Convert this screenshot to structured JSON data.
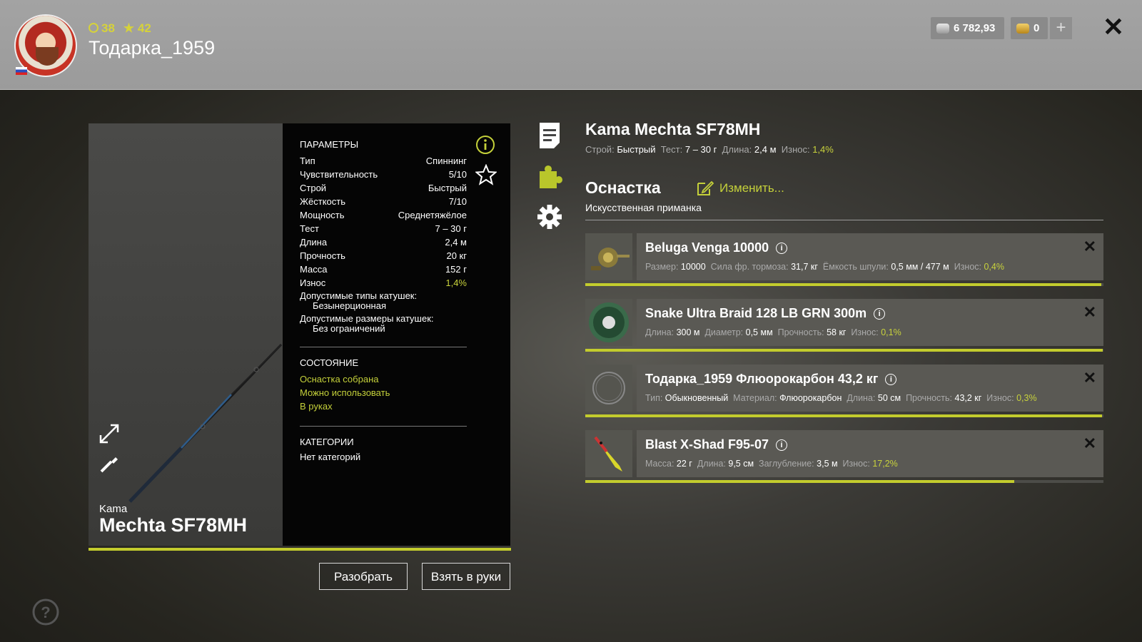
{
  "header": {
    "level": "38",
    "stars": "42",
    "player_name": "Тодарка_1959",
    "silver": "6 782,93",
    "gold": "0"
  },
  "rod": {
    "brand": "Kama",
    "model": "Mechta SF78MH",
    "title": "Kama Mechta SF78MH",
    "wear_fraction": 0.986
  },
  "params": {
    "section_title": "ПАРАМЕТРЫ",
    "rows": [
      {
        "label": "Тип",
        "value": "Спиннинг"
      },
      {
        "label": "Чувствительность",
        "value": "5/10"
      },
      {
        "label": "Строй",
        "value": "Быстрый"
      },
      {
        "label": "Жёсткость",
        "value": "7/10"
      },
      {
        "label": "Мощность",
        "value": "Среднетяжёлое"
      },
      {
        "label": "Тест",
        "value": "7 – 30 г"
      },
      {
        "label": "Длина",
        "value": "2,4 м"
      },
      {
        "label": "Прочность",
        "value": "20 кг"
      },
      {
        "label": "Масса",
        "value": "152 г"
      },
      {
        "label": "Износ",
        "value": "1,4%"
      }
    ],
    "reel_types_label": "Допустимые типы катушек:",
    "reel_types_value": "Безынерционная",
    "reel_sizes_label": "Допустимые размеры катушек:",
    "reel_sizes_value": "Без ограничений",
    "state_title": "СОСТОЯНИЕ",
    "states": [
      "Оснастка собрана",
      "Можно использовать",
      "В руках"
    ],
    "categories_title": "КАТЕГОРИИ",
    "categories_value": "Нет категорий"
  },
  "buttons": {
    "disassemble": "Разобрать",
    "take": "Взять в руки"
  },
  "summary": {
    "build_label": "Строй:",
    "build_value": "Быстрый",
    "test_label": "Тест:",
    "test_value": "7 – 30 г",
    "length_label": "Длина:",
    "length_value": "2,4 м",
    "wear_label": "Износ:",
    "wear_value": "1,4%"
  },
  "tackle": {
    "title": "Оснастка",
    "edit_label": "Изменить...",
    "subtitle": "Искусственная приманка",
    "items": [
      {
        "name": "Beluga Venga 10000",
        "fields": [
          {
            "label": "Размер:",
            "value": "10000"
          },
          {
            "label": "Сила фр. тормоза:",
            "value": "31,7 кг"
          },
          {
            "label": "Ёмкость шпули:",
            "value": "0,5 мм / 477 м"
          }
        ],
        "wear_label": "Износ:",
        "wear_value": "0,4%",
        "condition": 0.996
      },
      {
        "name": "Snake Ultra Braid 128 LB GRN 300m",
        "fields": [
          {
            "label": "Длина:",
            "value": "300 м"
          },
          {
            "label": "Диаметр:",
            "value": "0,5 мм"
          },
          {
            "label": "Прочность:",
            "value": "58 кг"
          }
        ],
        "wear_label": "Износ:",
        "wear_value": "0,1%",
        "condition": 0.999
      },
      {
        "name": "Тодарка_1959 Флюорокарбон 43,2 кг",
        "fields": [
          {
            "label": "Тип:",
            "value": "Обыкновенный"
          },
          {
            "label": "Материал:",
            "value": "Флюорокарбон"
          },
          {
            "label": "Длина:",
            "value": "50 см"
          },
          {
            "label": "Прочность:",
            "value": "43,2 кг"
          }
        ],
        "wear_label": "Износ:",
        "wear_value": "0,3%",
        "condition": 0.997
      },
      {
        "name": "Blast X-Shad F95-07",
        "fields": [
          {
            "label": "Масса:",
            "value": "22 г"
          },
          {
            "label": "Длина:",
            "value": "9,5 см"
          },
          {
            "label": "Заглубление:",
            "value": "3,5 м"
          }
        ],
        "wear_label": "Износ:",
        "wear_value": "17,2%",
        "condition": 0.828
      }
    ]
  },
  "colors": {
    "accent": "#c3cc2d",
    "wear_text": "#c8d23c",
    "header_bg": "#a0a0a0",
    "panel_bg": "#050505"
  }
}
